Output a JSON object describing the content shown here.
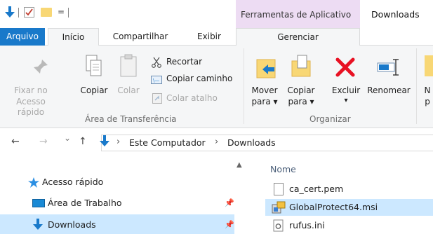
{
  "titlebar": {
    "qa_dropdown": "=",
    "context_tab": "Ferramentas de Aplicativo",
    "window_title": "Downloads"
  },
  "tabs": {
    "arquivo": "Arquivo",
    "inicio": "Início",
    "compartilhar": "Compartilhar",
    "exibir": "Exibir",
    "gerenciar": "Gerenciar"
  },
  "ribbon": {
    "clipboard": {
      "pin_line1": "Fixar no",
      "pin_line2": "Acesso rápido",
      "copy": "Copiar",
      "paste": "Colar",
      "cut": "Recortar",
      "copy_path": "Copiar caminho",
      "paste_shortcut": "Colar atalho",
      "group_label": "Área de Transferência"
    },
    "organize": {
      "move_line1": "Mover",
      "move_line2": "para ▾",
      "copyto_line1": "Copiar",
      "copyto_line2": "para ▾",
      "delete": "Excluir",
      "delete_arrow": "▾",
      "rename": "Renomear",
      "new_cut_1": "N",
      "new_cut_2": "p",
      "group_label": "Organizar"
    }
  },
  "address": {
    "back": "←",
    "forward": "→",
    "recent": "⌄",
    "up": "↑",
    "sep1": "›",
    "part1": "Este Computador",
    "sep2": "›",
    "part2": "Downloads"
  },
  "navpane": {
    "items": [
      {
        "label": "Acesso rápido"
      },
      {
        "label": "Área de Trabalho"
      },
      {
        "label": "Downloads"
      }
    ]
  },
  "content": {
    "column_name": "Nome",
    "files": [
      {
        "name": "ca_cert.pem"
      },
      {
        "name": "GlobalProtect64.msi"
      },
      {
        "name": "rufus.ini"
      }
    ]
  },
  "colors": {
    "accent": "#1979ca",
    "context_tab_bg": "#eddcf3",
    "selection": "#cce8ff",
    "delete_red": "#e81123"
  }
}
